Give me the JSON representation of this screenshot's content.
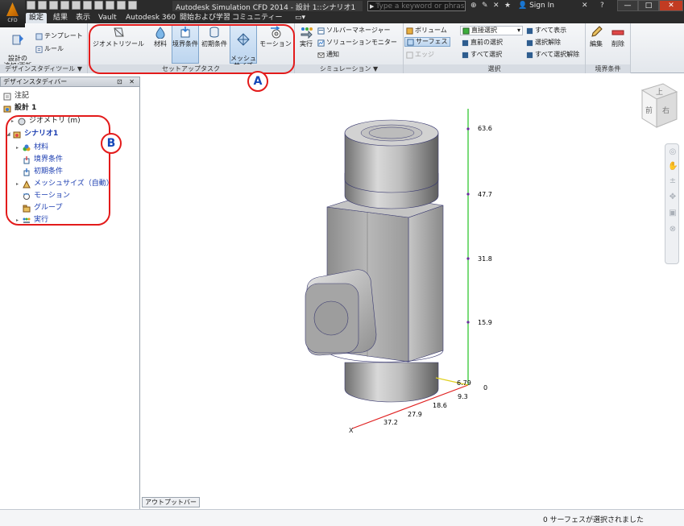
{
  "app": {
    "logo_text": "CFD",
    "window_title": "Autodesk Simulation CFD 2014 - 設計 1::シナリオ1"
  },
  "search": {
    "placeholder": "Type a keyword or phrase"
  },
  "account": {
    "sign_in": "Sign In"
  },
  "ribbon_tabs": [
    {
      "label": "設定",
      "active": true
    },
    {
      "label": "結果"
    },
    {
      "label": "表示"
    },
    {
      "label": "Vault"
    },
    {
      "label": "Autodesk 360"
    },
    {
      "label": "開始および学習"
    },
    {
      "label": "コミュニティー"
    }
  ],
  "ribbon": {
    "design_study_tools": {
      "footer": "デザインスタディツール ▼",
      "add_update": "設計の\n追加/更新",
      "template": "テンプレート",
      "rule": "ルール"
    },
    "setup_tasks": {
      "footer": "セットアップタスク",
      "geometry_tools": "ジオメトリツール",
      "material": "材料",
      "boundary_conditions": "境界条件",
      "initial_conditions": "初期条件",
      "mesh_size": "メッシュ\nサイズ",
      "motion": "モーション"
    },
    "simulation": {
      "footer": "シミュレーション ▼",
      "run": "実行",
      "solver_manager": "ソルバーマネージャー",
      "solution_monitor": "ソリューションモニター",
      "notify": "通知"
    },
    "selection": {
      "footer": "選択",
      "volume": "ボリューム",
      "surface": "サーフェス",
      "edge": "エッジ",
      "select_mode": "直接選択",
      "previous_selection": "直前の選択",
      "select_all": "すべて選択",
      "show_all": "すべて表示",
      "deselect": "選択解除",
      "deselect_all": "すべて選択解除"
    },
    "boundary": {
      "footer": "境界条件",
      "edit": "編集",
      "delete": "削除"
    }
  },
  "callouts": {
    "a": "A",
    "b": "B"
  },
  "design_study_bar": {
    "title": "デザインスタディバー",
    "controls": "⊡ ✕",
    "tree": {
      "notes": "注記",
      "design": "設計 1",
      "geometry": "ジオメトリ (m)",
      "scenario": "シナリオ1",
      "material": "材料",
      "boundary": "境界条件",
      "initial": "初期条件",
      "mesh_size": "メッシュサイズ（自動）",
      "motion": "モーション",
      "groups": "グループ",
      "run": "実行"
    }
  },
  "viewcube": {
    "top": "上",
    "front": "前",
    "right": "右"
  },
  "ruler": {
    "y_ticks": [
      "63.6",
      "47.7",
      "31.8",
      "15.9",
      "0"
    ],
    "x_ticks": [
      "37.2",
      "27.9",
      "18.6",
      "9.3"
    ],
    "z_tick": "6.79",
    "x_label": "X"
  },
  "output_bar": {
    "label": "アウトプットバー"
  },
  "status": {
    "text": "0 サーフェスが選択されました"
  },
  "colors": {
    "accent": "#e31b1b",
    "y_axis": "#22c322",
    "x_axis": "#e02020",
    "tree_blue": "#1a3cb0"
  }
}
